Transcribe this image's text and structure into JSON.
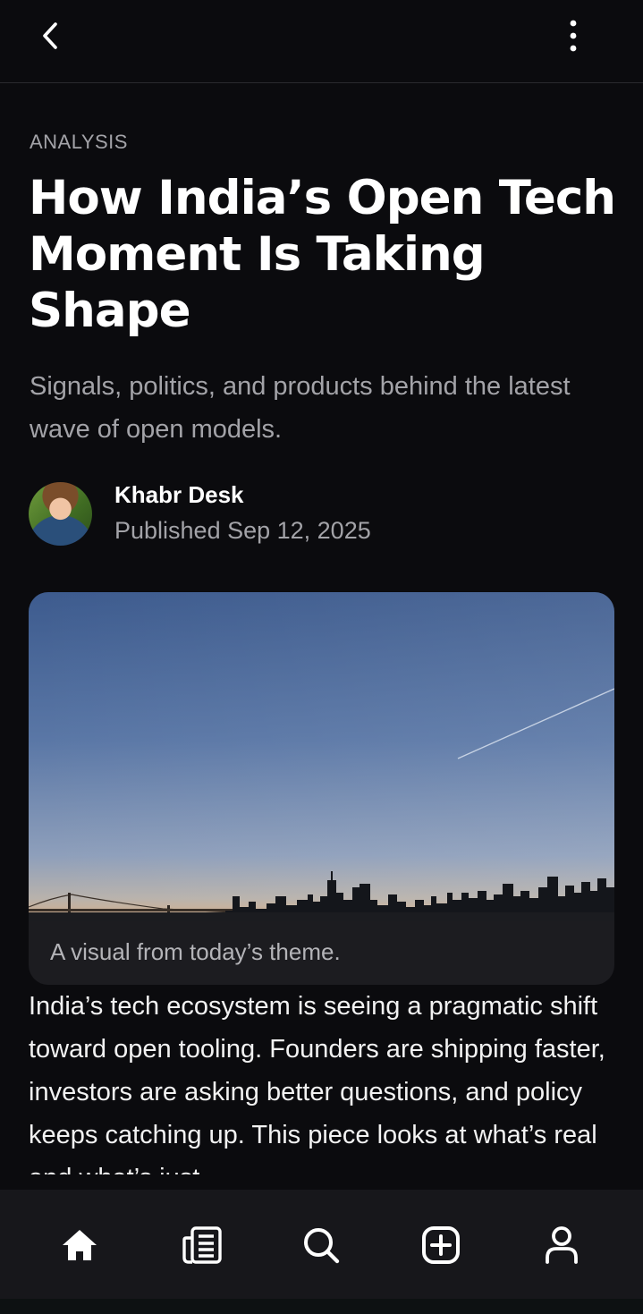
{
  "article": {
    "kicker": "ANALYSIS",
    "title": "How India’s Open Tech Moment Is Taking Shape",
    "subtitle": "Signals, politics, and products behind the latest wave of open models.",
    "author": "Khabr Desk",
    "published": "Published Sep 12, 2025",
    "caption": "A visual from today’s theme.",
    "body": "India’s tech ecosystem is seeing a pragmatic shift toward open tooling. Founders are shipping faster, investors are asking better questions, and policy keeps catching up. This piece looks at what’s real and what’s just"
  },
  "icons": {
    "back": "back-chevron-icon",
    "more": "more-vertical-icon",
    "nav": [
      "home-icon",
      "newspaper-icon",
      "search-icon",
      "add-box-icon",
      "profile-icon"
    ]
  },
  "colors": {
    "background": "#0b0b0e",
    "muted_text": "#a3a3a8",
    "nav_background": "#17171b"
  }
}
